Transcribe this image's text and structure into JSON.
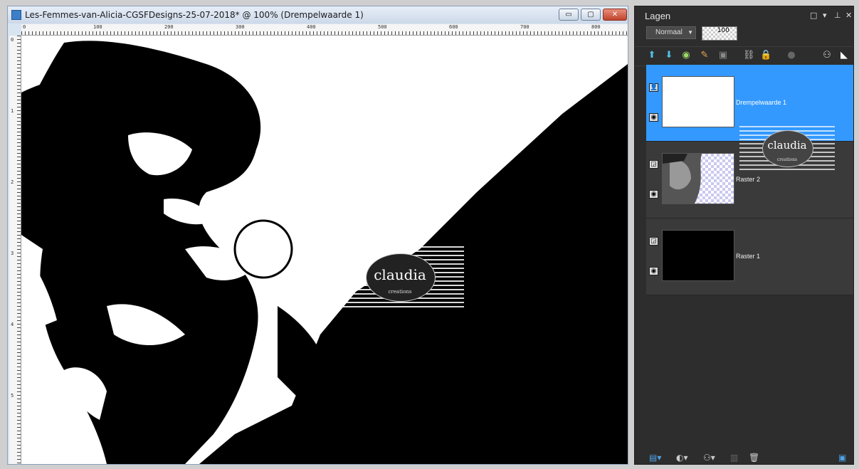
{
  "document": {
    "title": "Les-Femmes-van-Alicia-CGSFDesigns-25-07-2018* @ 100% (Drempelwaarde 1)",
    "buttons": {
      "minimize": "▭",
      "maximize": "▢",
      "close": "✕"
    },
    "ruler_h_labels": [
      "0",
      "100",
      "200",
      "300",
      "400",
      "500",
      "600",
      "700",
      "800"
    ],
    "ruler_v_labels": [
      "0",
      "1",
      "2",
      "3",
      "4",
      "5"
    ],
    "watermark": {
      "text": "claudia",
      "subtext": "creations"
    }
  },
  "layers_panel": {
    "title": "Lagen",
    "header_buttons": [
      "□",
      "▾",
      "⊥",
      "✕"
    ],
    "blend_mode": "Normaal",
    "opacity": "100",
    "toolbar_icons": [
      "move-layer-up-icon",
      "move-layer-down-icon",
      "visibility-toggle-icon",
      "edit-icon",
      "mask-icon",
      "link-icon",
      "lock-icon",
      "blend-icon",
      "mask-view-icon",
      "bw-icon"
    ],
    "layers": [
      {
        "name": "Drempelwaarde 1",
        "selected": true,
        "thumb": "white"
      },
      {
        "name": "Raster 2",
        "selected": false,
        "thumb": "photo"
      },
      {
        "name": "Raster 1",
        "selected": false,
        "thumb": "black"
      }
    ],
    "watermark": {
      "text": "claudia",
      "subtext": "creations"
    }
  },
  "colors": {
    "selection": "#3399ff",
    "panel_bg": "#2d2d2d",
    "canvas_bg": "#000000"
  }
}
